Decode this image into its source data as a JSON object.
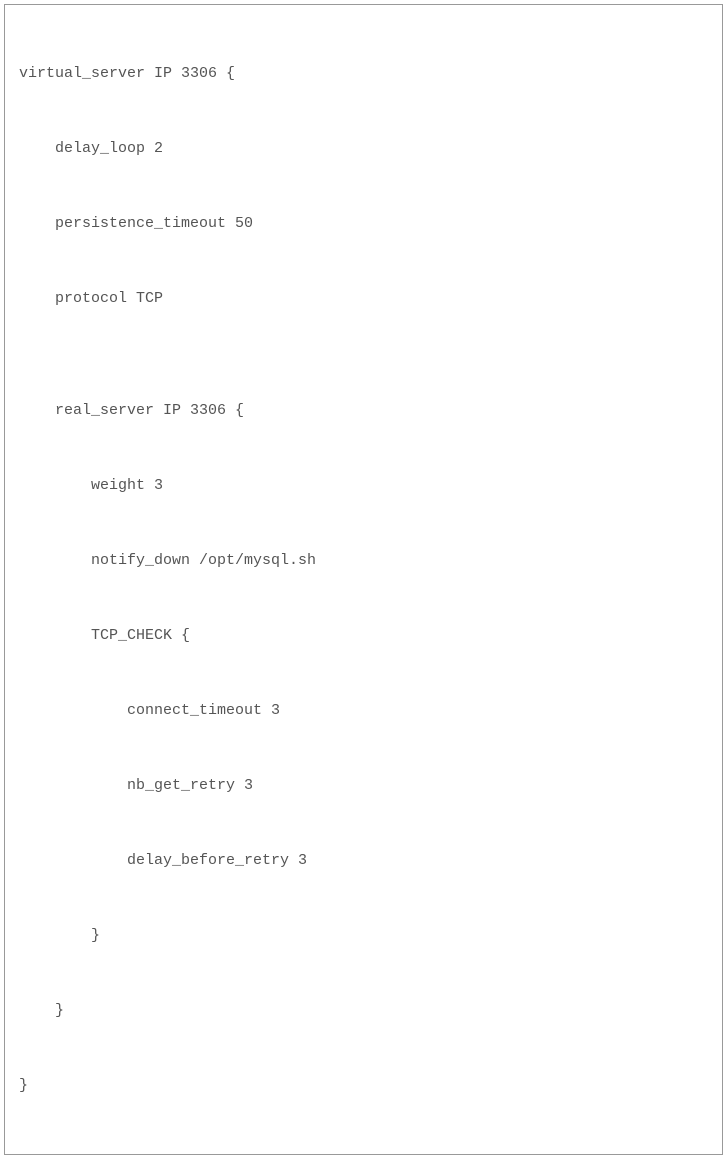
{
  "code": {
    "lines": [
      "virtual_server IP 3306 {",
      "    delay_loop 2",
      "    persistence_timeout 50",
      "    protocol TCP",
      "",
      "    real_server IP 3306 {",
      "        weight 3",
      "        notify_down /opt/mysql.sh",
      "        TCP_CHECK {",
      "            connect_timeout 3",
      "            nb_get_retry 3",
      "            delay_before_retry 3",
      "        }",
      "    }",
      "}"
    ]
  }
}
